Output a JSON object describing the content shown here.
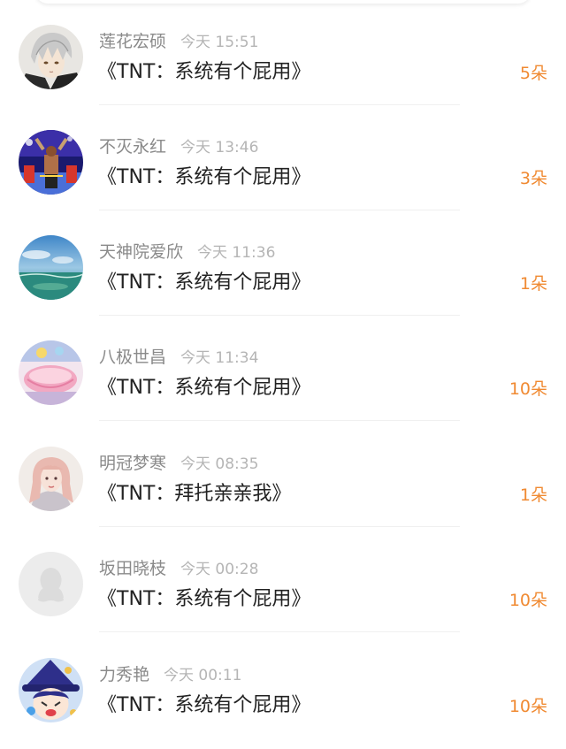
{
  "records": [
    {
      "name": "莲花宏硕",
      "time": "今天 15:51",
      "gift": "《TNT：系统有个屁用》",
      "count": "5朵",
      "avatar": "anime-silver-hair-avatar"
    },
    {
      "name": "不灭永红",
      "time": "今天 13:46",
      "gift": "《TNT：系统有个屁用》",
      "count": "3朵",
      "avatar": "stage-performer-avatar"
    },
    {
      "name": "天神院爱欣",
      "time": "今天 11:36",
      "gift": "《TNT：系统有个屁用》",
      "count": "1朵",
      "avatar": "ocean-sky-avatar"
    },
    {
      "name": "八极世昌",
      "time": "今天 11:34",
      "gift": "《TNT：系统有个屁用》",
      "count": "10朵",
      "avatar": "pink-dessert-avatar"
    },
    {
      "name": "明冠梦寒",
      "time": "今天 08:35",
      "gift": "《TNT：拜托亲亲我》",
      "count": "1朵",
      "avatar": "girl-portrait-avatar"
    },
    {
      "name": "坂田晓枝",
      "time": "今天 00:28",
      "gift": "《TNT：系统有个屁用》",
      "count": "10朵",
      "avatar": "default-penguin-avatar"
    },
    {
      "name": "力秀艳",
      "time": "今天 00:11",
      "gift": "《TNT：系统有个屁用》",
      "count": "10朵",
      "avatar": "cartoon-witch-avatar"
    }
  ],
  "colors": {
    "count": "#f08a32",
    "name": "#8a8a8a",
    "time": "#b5b5b5",
    "gift": "#222222"
  }
}
